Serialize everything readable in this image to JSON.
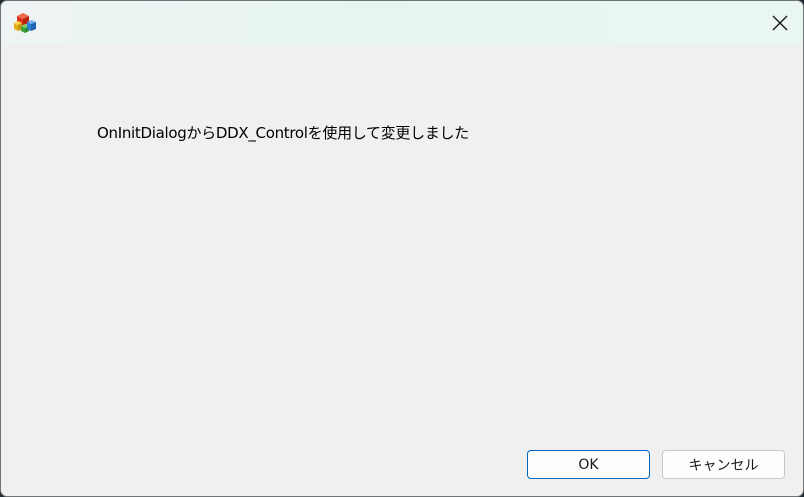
{
  "dialog": {
    "message": "OnInitDialogからDDX_Controlを使用して変更しました"
  },
  "titlebar": {
    "icon": "app-blocks-icon",
    "close": "close-icon"
  },
  "buttons": {
    "ok_label": "OK",
    "cancel_label": "キャンセル"
  },
  "colors": {
    "accent": "#0067c0",
    "dialog_bg": "#f0f0f0",
    "titlebar_tint": "#e7f5f0"
  }
}
